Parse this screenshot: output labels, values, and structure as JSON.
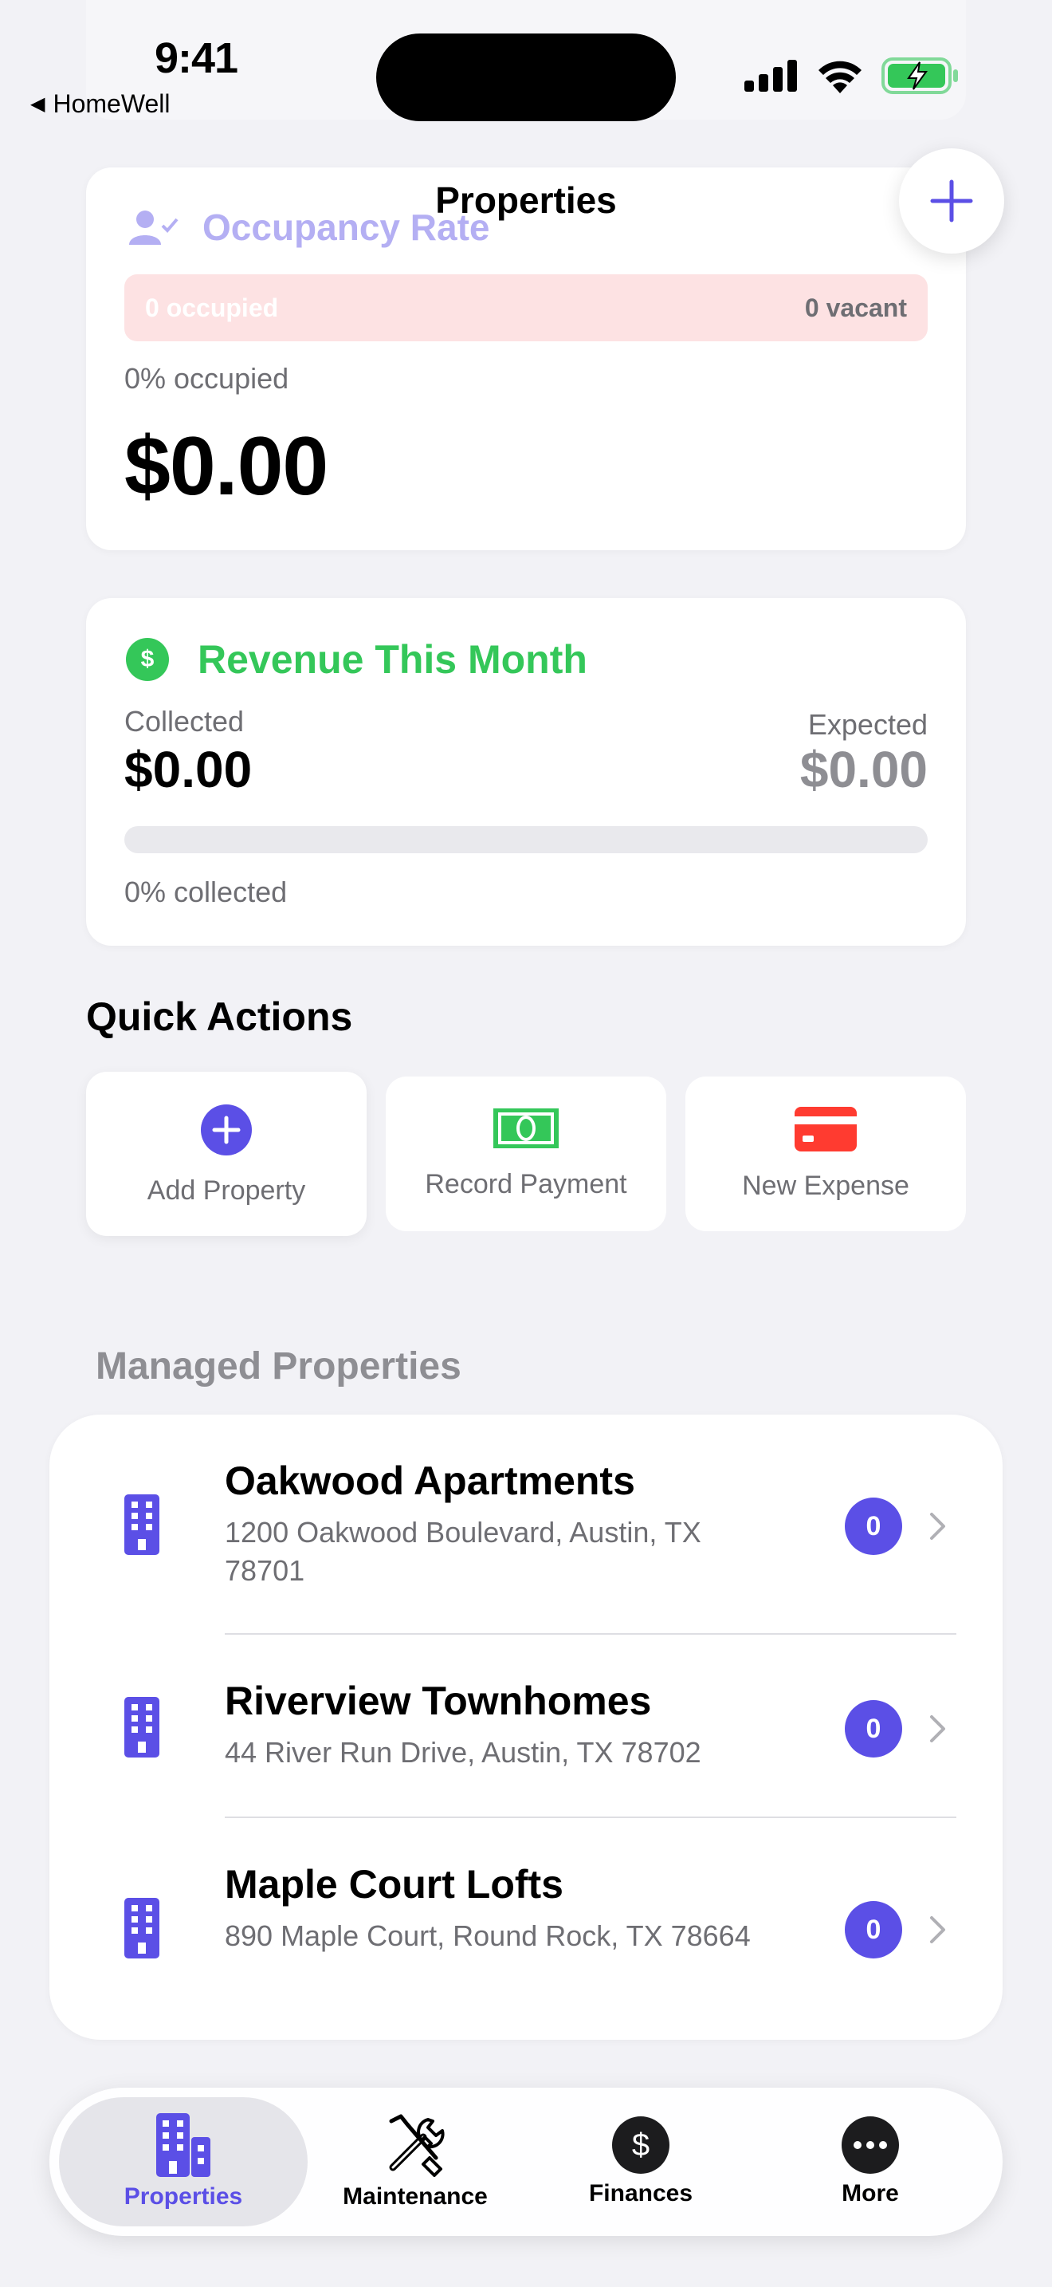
{
  "status_bar": {
    "time": "9:41",
    "back_app": "HomeWell"
  },
  "header": {
    "title": "Properties"
  },
  "occupancy": {
    "title": "Occupancy Rate",
    "occupied_label": "0 occupied",
    "vacant_label": "0 vacant",
    "percent_text": "0% occupied",
    "amount": "$0.00"
  },
  "revenue": {
    "title": "Revenue This Month",
    "collected_label": "Collected",
    "collected_value": "$0.00",
    "expected_label": "Expected",
    "expected_value": "$0.00",
    "progress_fraction": 0,
    "percent_text": "0% collected",
    "accent_color": "#34c759"
  },
  "quick_actions": {
    "title": "Quick Actions",
    "items": [
      {
        "label": "Add Property",
        "icon": "plus-circle-icon"
      },
      {
        "label": "Record Payment",
        "icon": "banknote-icon"
      },
      {
        "label": "New Expense",
        "icon": "credit-card-icon"
      }
    ]
  },
  "managed_properties": {
    "title": "Managed Properties",
    "items": [
      {
        "name": "Oakwood Apartments",
        "address": "1200 Oakwood Boulevard, Austin, TX 78701",
        "count": "0"
      },
      {
        "name": "Riverview Townhomes",
        "address": "44 River Run Drive, Austin, TX 78702",
        "count": "0"
      },
      {
        "name": "Maple Court Lofts",
        "address": "890 Maple Court, Round Rock, TX 78664",
        "count": "0"
      }
    ]
  },
  "tab_bar": {
    "tabs": [
      {
        "label": "Properties",
        "icon": "building-icon",
        "active": true
      },
      {
        "label": "Maintenance",
        "icon": "tools-icon",
        "active": false
      },
      {
        "label": "Finances",
        "icon": "dollar-circle-icon",
        "active": false
      },
      {
        "label": "More",
        "icon": "more-icon",
        "active": false
      }
    ]
  },
  "colors": {
    "accent": "#5b4fe6",
    "success": "#34c759",
    "danger": "#ff3b30",
    "background": "#f2f2f6"
  }
}
